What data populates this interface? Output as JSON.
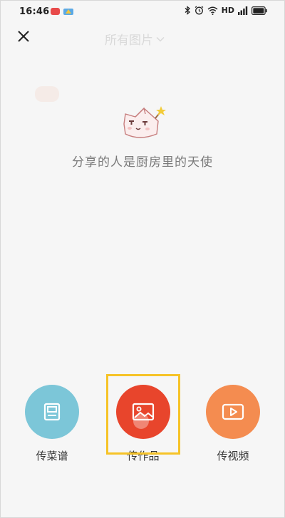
{
  "status_bar": {
    "time": "16:46",
    "network_label": "HD",
    "icons": [
      "red-app-notification-icon",
      "app-notification-icon",
      "bluetooth-icon",
      "alarm-icon",
      "wifi-icon",
      "signal-icon",
      "battery-icon"
    ]
  },
  "header": {
    "title": "所有图片",
    "title_color": "#d9d9d9",
    "close_icon": "close-icon",
    "dropdown_icon": "chevron-down-icon"
  },
  "empty_state": {
    "message": "分享的人是厨房里的天使"
  },
  "actions": [
    {
      "label": "传菜谱",
      "icon": "recipe-icon",
      "color": "#7cc6d8"
    },
    {
      "label": "传作品",
      "icon": "image-icon",
      "color": "#e8452c"
    },
    {
      "label": "传视频",
      "icon": "video-icon",
      "color": "#f48c50"
    }
  ],
  "highlight_color": "#f6c328"
}
